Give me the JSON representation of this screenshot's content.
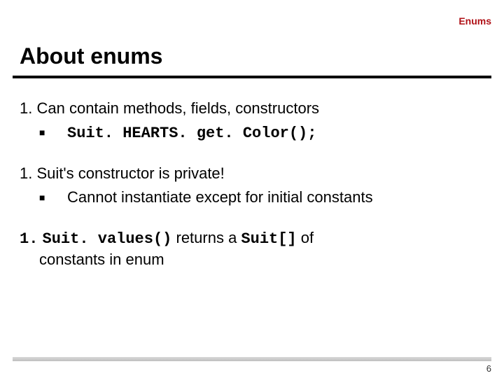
{
  "header": {
    "label": "Enums"
  },
  "title": "About enums",
  "items": [
    {
      "num": "1.",
      "text": "Can contain methods, fields, constructors",
      "sub": {
        "bullet": "■",
        "code": "Suit. HEARTS. get. Color();"
      }
    },
    {
      "num": "1.",
      "text": "Suit's constructor is private!",
      "sub": {
        "bullet": "■",
        "text": "Cannot instantiate except for initial constants"
      }
    },
    {
      "num": "1.",
      "code1": "Suit. values()",
      "mid": " returns a ",
      "code2": "Suit[]",
      "tail1": " of",
      "tail2": "constants in enum"
    }
  ],
  "page_number": "6"
}
